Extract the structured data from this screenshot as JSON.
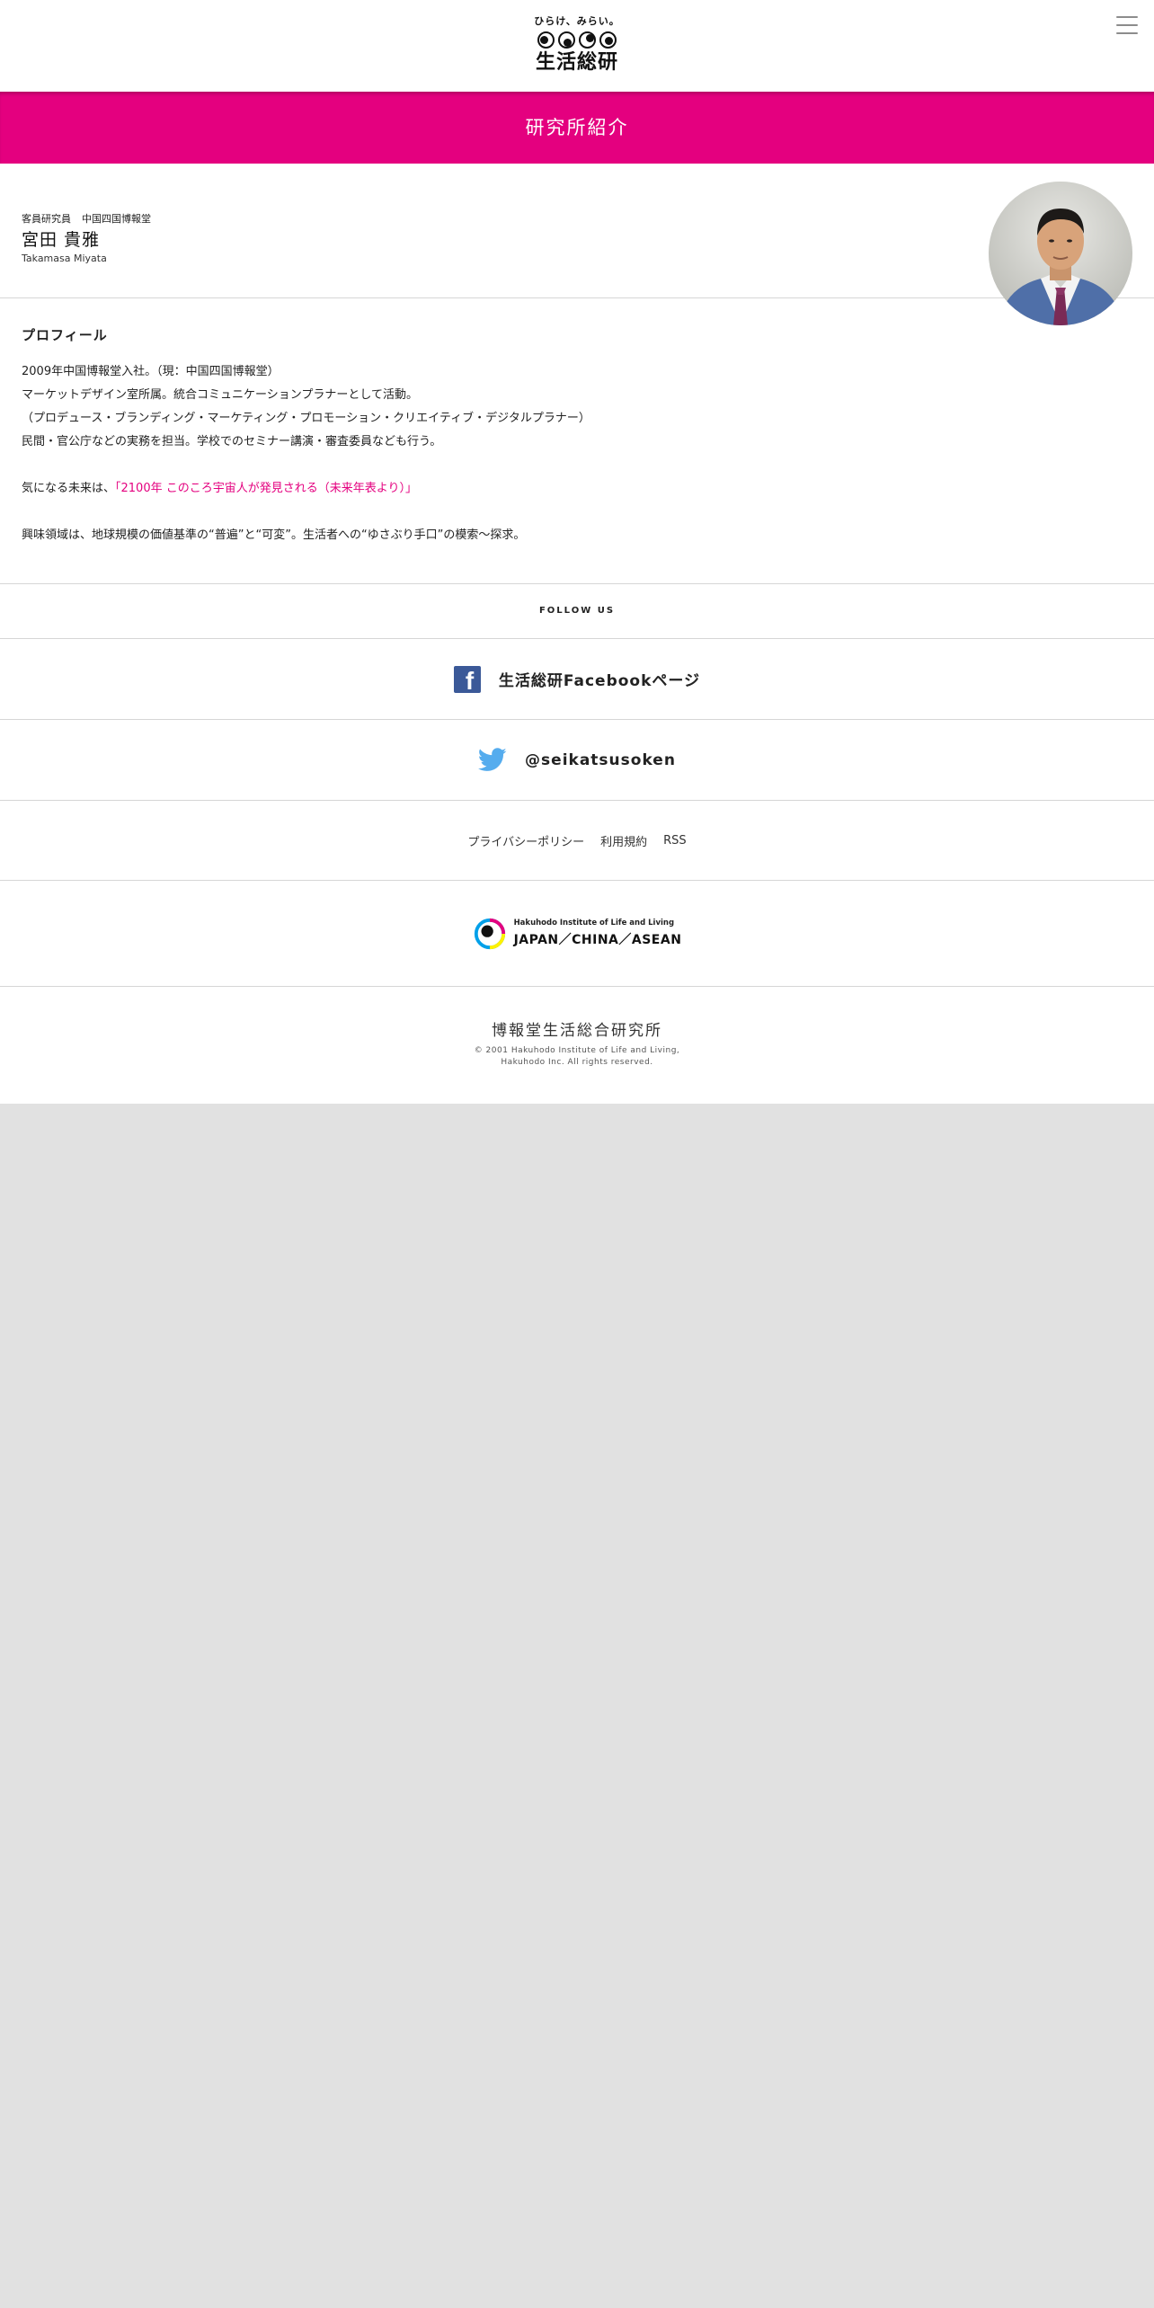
{
  "header": {
    "tagline": "ひらけ、みらい。",
    "logo_name": "生活総研"
  },
  "title_bar": "研究所紹介",
  "person": {
    "role": "客員研究員",
    "office": "中国四国博報堂",
    "name": "宮田 貴雅",
    "name_roman": "Takamasa Miyata"
  },
  "profile": {
    "heading": "プロフィール",
    "bio_lines": [
      "2009年中国博報堂入社。（現：中国四国博報堂）",
      "マーケットデザイン室所属。統合コミュニケーションプラナーとして活動。",
      "（プロデュース・ブランディング・マーケティング・プロモーション・クリエイティブ・デジタルプラナー）",
      "民間・官公庁などの実務を担当。学校でのセミナー講演・審査委員なども行う。"
    ],
    "future_prefix": "気になる未来は、",
    "future_link": "「2100年 このころ宇宙人が発見される（未来年表より）」",
    "interest": "興味領域は、地球規模の価値基準の“普遍”と“可変”。生活者への“ゆさぶり手口”の模索～探求。"
  },
  "follow": {
    "heading": "FOLLOW US",
    "facebook_label": "生活総研Facebookページ",
    "twitter_label": "@seikatsusoken"
  },
  "footer": {
    "links": [
      "プライバシーポリシー",
      "利用規約",
      "RSS"
    ],
    "inst_small": "Hakuhodo Institute of Life and Living",
    "inst_main": "JAPAN／CHINA／ASEAN",
    "corp_name": "博報堂生活総合研究所",
    "copyright_1": "© 2001 Hakuhodo Institute of Life and Living,",
    "copyright_2": "Hakuhodo Inc. All rights reserved."
  },
  "colors": {
    "accent": "#e4007f",
    "facebook": "#3b5998",
    "twitter": "#55acee",
    "page_bg": "#e1e1e1"
  }
}
